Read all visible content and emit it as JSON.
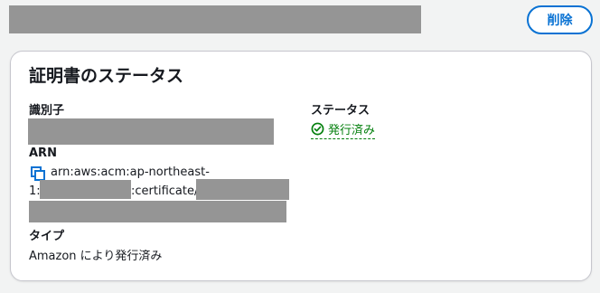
{
  "header": {
    "delete_label": "削除"
  },
  "panel": {
    "title": "証明書のステータス",
    "identifier_label": "識別子",
    "arn_label": "ARN",
    "arn_prefix": "arn:aws:acm:ap-northeast-",
    "arn_region_suffix": "1:",
    "arn_certificate": ":certificate/",
    "type_label": "タイプ",
    "type_value": "Amazon により発行済み",
    "status_label": "ステータス",
    "status_value": "発行済み"
  },
  "colors": {
    "accent": "#0972d3",
    "success": "#037f0c",
    "redaction": "#959595"
  },
  "icons": {
    "status": "check-circle-icon",
    "copy": "copy-icon"
  }
}
